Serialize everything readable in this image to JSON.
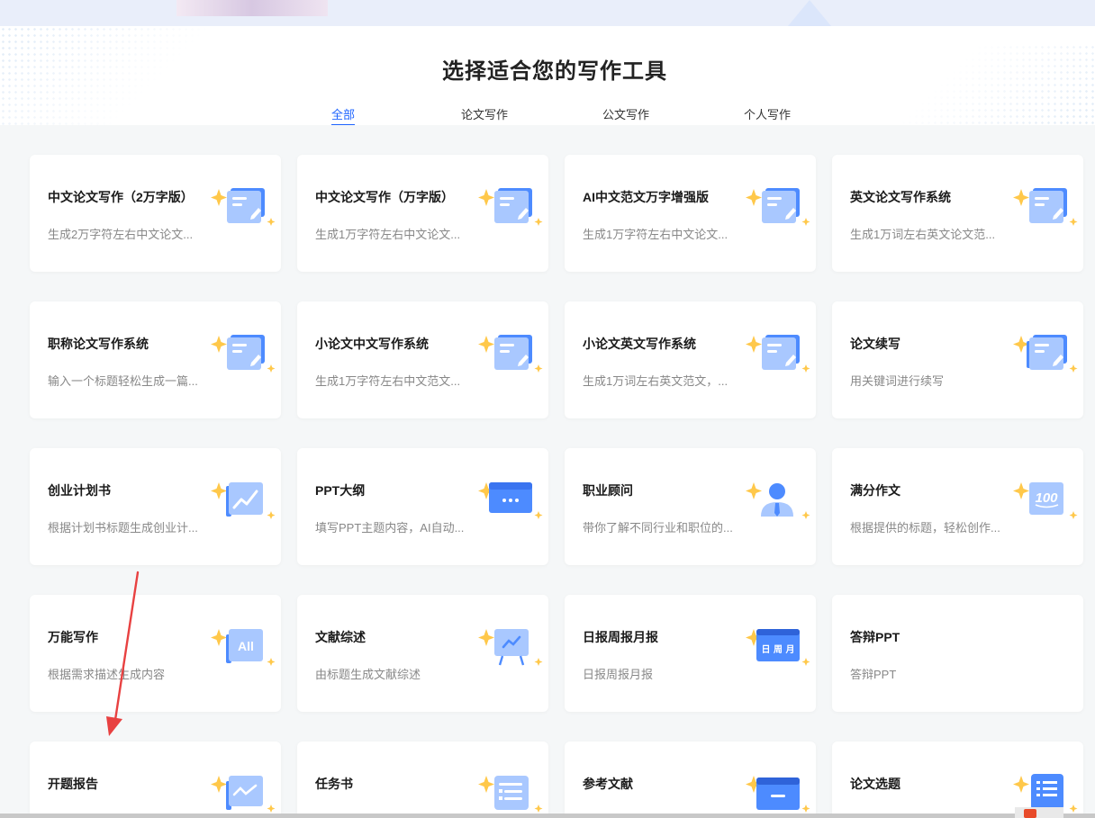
{
  "page": {
    "title": "选择适合您的写作工具",
    "accent_color": "#1e64ff"
  },
  "tabs": [
    {
      "label": "全部",
      "active": true
    },
    {
      "label": "论文写作",
      "active": false
    },
    {
      "label": "公文写作",
      "active": false
    },
    {
      "label": "个人写作",
      "active": false
    }
  ],
  "cards": [
    {
      "title": "中文论文写作（2万字版）",
      "desc": "生成2万字符左右中文论文...",
      "icon": "doc-pen-icon"
    },
    {
      "title": "中文论文写作（万字版）",
      "desc": "生成1万字符左右中文论文...",
      "icon": "doc-pen-icon"
    },
    {
      "title": "AI中文范文万字增强版",
      "desc": "生成1万字符左右中文论文...",
      "icon": "doc-pen-icon"
    },
    {
      "title": "英文论文写作系统",
      "desc": "生成1万词左右英文论文范...",
      "icon": "doc-pen-icon"
    },
    {
      "title": "职称论文写作系统",
      "desc": "输入一个标题轻松生成一篇...",
      "icon": "doc-pen-icon"
    },
    {
      "title": "小论文中文写作系统",
      "desc": "生成1万字符左右中文范文...",
      "icon": "doc-pen-icon"
    },
    {
      "title": "小论文英文写作系统",
      "desc": "生成1万词左右英文范文，...",
      "icon": "doc-pen-icon"
    },
    {
      "title": "论文续写",
      "desc": "用关键词进行续写",
      "icon": "notebook-pen-icon"
    },
    {
      "title": "创业计划书",
      "desc": "根据计划书标题生成创业计...",
      "icon": "trend-chart-icon"
    },
    {
      "title": "PPT大纲",
      "desc": "填写PPT主题内容，AI自动...",
      "icon": "slides-icon"
    },
    {
      "title": "职业顾问",
      "desc": "带你了解不同行业和职位的...",
      "icon": "person-tie-icon"
    },
    {
      "title": "满分作文",
      "desc": "根据提供的标题，轻松创作...",
      "icon": "score-100-icon"
    },
    {
      "title": "万能写作",
      "desc": "根据需求描述生成内容",
      "icon": "all-badge-icon",
      "badge": "All"
    },
    {
      "title": "文献综述",
      "desc": "由标题生成文献综述",
      "icon": "easel-chart-icon"
    },
    {
      "title": "日报周报月报",
      "desc": "日报周报月报",
      "icon": "calendar-icon",
      "badge": "日 周 月"
    },
    {
      "title": "答辩PPT",
      "desc": "答辩PPT",
      "icon": "none"
    },
    {
      "title": "开题报告",
      "desc": "",
      "icon": "report-chart-icon"
    },
    {
      "title": "任务书",
      "desc": "",
      "icon": "checklist-icon"
    },
    {
      "title": "参考文献",
      "desc": "",
      "icon": "folder-icon"
    },
    {
      "title": "论文选题",
      "desc": "",
      "icon": "list-doc-icon"
    }
  ],
  "colors": {
    "icon_blue_light": "#a9c8ff",
    "icon_blue": "#4d8bff",
    "sparkle": "#ffc84a"
  }
}
